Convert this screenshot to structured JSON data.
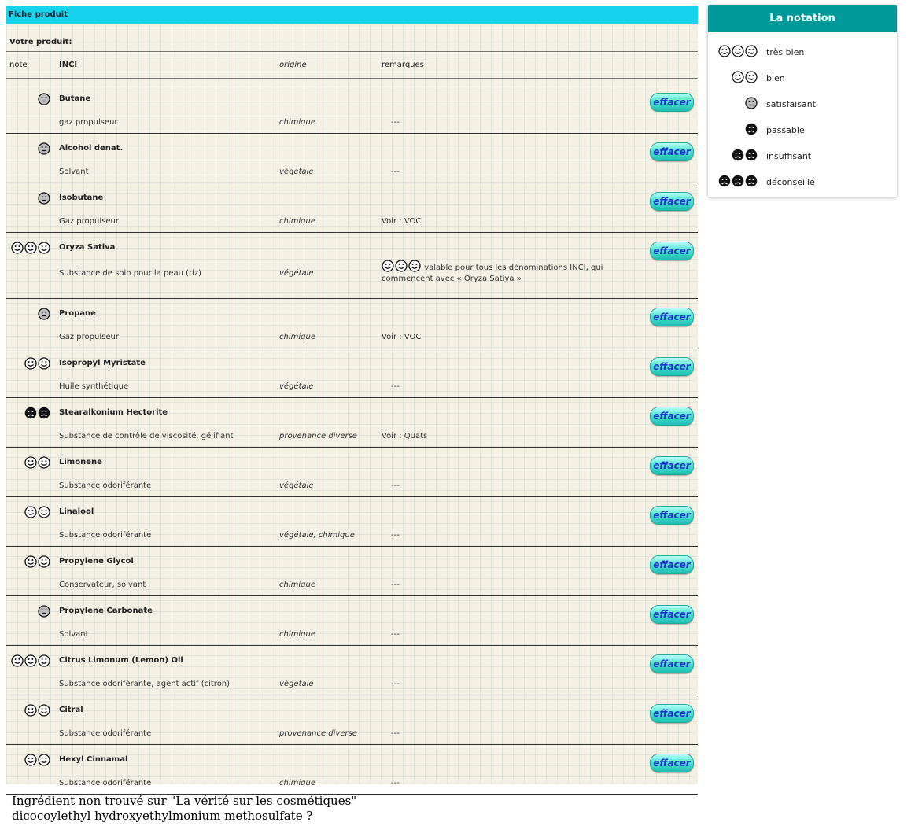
{
  "panel": {
    "title": "Fiche produit",
    "product_label": "Votre produit:",
    "headers": {
      "note": "note",
      "inci": "INCI",
      "origin": "origine",
      "remarks": "remarques"
    }
  },
  "button_label": "effacer",
  "rows": [
    {
      "rating": "satisfaisant",
      "inci": "Butane",
      "function": "gaz propulseur",
      "origin": "chimique",
      "remark": "---"
    },
    {
      "rating": "satisfaisant",
      "inci": "Alcohol denat.",
      "function": "Solvant",
      "origin": "végétale",
      "remark": "---"
    },
    {
      "rating": "satisfaisant",
      "inci": "Isobutane",
      "function": "Gaz propulseur",
      "origin": "chimique",
      "remark": "Voir : VOC"
    },
    {
      "rating": "très bien",
      "inci": "Oryza Sativa",
      "function": "Substance de soin pour la peau (riz)",
      "origin": "végétale",
      "remark": "valable pour tous les dénominations INCI, qui commencent avec « Oryza Sativa »"
    },
    {
      "rating": "satisfaisant",
      "inci": "Propane",
      "function": "Gaz propulseur",
      "origin": "chimique",
      "remark": "Voir : VOC"
    },
    {
      "rating": "bien",
      "inci": "Isopropyl Myristate",
      "function": "Huile synthétique",
      "origin": "végétale",
      "remark": "---"
    },
    {
      "rating": "insuffisant",
      "inci": "Stearalkonium Hectorite",
      "function": "Substance de contrôle de viscosité, gélifiant",
      "origin": "provenance diverse",
      "remark": "Voir : Quats"
    },
    {
      "rating": "bien",
      "inci": "Limonene",
      "function": "Substance odoriférante",
      "origin": "végétale",
      "remark": "---"
    },
    {
      "rating": "bien",
      "inci": "Linalool",
      "function": "Substance odoriférante",
      "origin": "végétale, chimique",
      "remark": "---"
    },
    {
      "rating": "bien",
      "inci": "Propylene Glycol",
      "function": "Conservateur, solvant",
      "origin": "chimique",
      "remark": "---"
    },
    {
      "rating": "satisfaisant",
      "inci": "Propylene Carbonate",
      "function": "Solvant",
      "origin": "chimique",
      "remark": "---"
    },
    {
      "rating": "très bien",
      "inci": "Citrus Limonum (Lemon) Oil",
      "function": "Substance odoriférante, agent actif (citron)",
      "origin": "végétale",
      "remark": "---"
    },
    {
      "rating": "bien",
      "inci": "Citral",
      "function": "Substance odoriférante",
      "origin": "provenance diverse",
      "remark": "---"
    },
    {
      "rating": "bien",
      "inci": "Hexyl Cinnamal",
      "function": "Substance odoriférante",
      "origin": "chimique",
      "remark": "---"
    }
  ],
  "legend": {
    "title": "La notation",
    "items": [
      {
        "rating": "très bien",
        "label": "très bien"
      },
      {
        "rating": "bien",
        "label": "bien"
      },
      {
        "rating": "satisfaisant",
        "label": "satisfaisant"
      },
      {
        "rating": "passable",
        "label": "passable"
      },
      {
        "rating": "insuffisant",
        "label": "insuffisant"
      },
      {
        "rating": "déconseillé",
        "label": "déconseillé"
      }
    ]
  },
  "ratings": {
    "très bien": {
      "icon": "smile-face-icon",
      "count": 3
    },
    "bien": {
      "icon": "smile-face-icon",
      "count": 2
    },
    "satisfaisant": {
      "icon": "neutral-face-icon",
      "count": 1
    },
    "passable": {
      "icon": "frown-face-icon",
      "count": 1
    },
    "insuffisant": {
      "icon": "frown-face-icon",
      "count": 2
    },
    "déconseillé": {
      "icon": "frown-face-icon",
      "count": 3
    }
  },
  "footer": {
    "line1": "Ingrédient non trouvé sur \"La vérité sur les cosmétiques\"",
    "line2": "dicocoylethyl hydroxyethylmonium methosulfate  ?"
  }
}
